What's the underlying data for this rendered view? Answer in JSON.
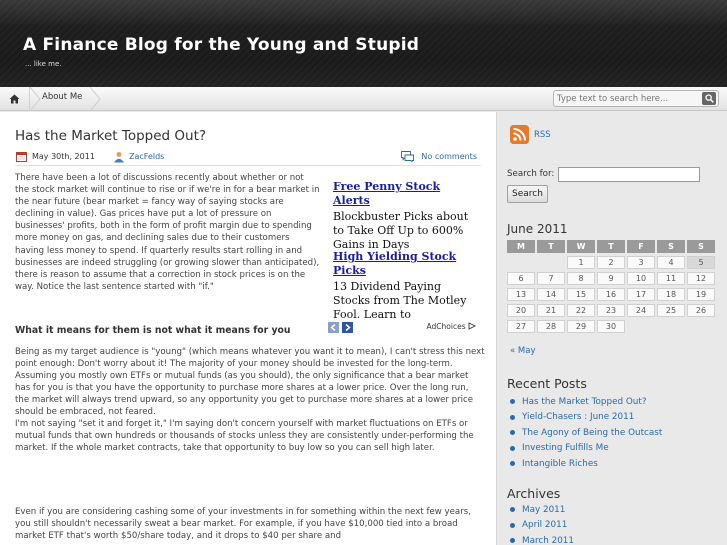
{
  "site": {
    "title": "A Finance Blog for the Young and Stupid",
    "description": "... like me."
  },
  "nav": {
    "home_icon": "home-icon",
    "items": [
      {
        "label": "About Me"
      }
    ],
    "search_placeholder": "Type text to search here..."
  },
  "post": {
    "title": "Has the Market Topped Out?",
    "date": "May 30th, 2011",
    "author": "ZacFelds",
    "comments": "No comments",
    "para1": "There have been a lot of discussions recently about whether or not the stock market will continue to rise or if we're in for a bear market in the near future (bear market = fancy way of saying stocks are declining in value). Gas prices have put a lot of pressure on businesses' profits, both in the form of profit margin due to spending more money on gas, and declining sales due to their customers having less money to spend. If quarterly results start rolling in and businesses are indeed struggling (or growing slower than anticipated), there is reason to assume that a correction in stock prices is on the way. Notice the last sentence started with \"if.\"",
    "subheading": "What it means for them is not what it means for you",
    "para2": "Being as my target audience is \"young\" (which means whatever you want it to mean), I can't stress this next point enough: Don't worry about it! The majority of your money should be invested for the long-term. Assuming you mostly own ETFs or mutual funds (as you should), the only significance that a bear market has for you is that you have the opportunity to purchase more shares at a lower price. Over the long run, the market will always trend upward, so any opportunity you get to purchase more shares at a lower price should be embraced, not feared.",
    "para3": "I'm not saying \"set it and forget it,\" I'm saying don't concern yourself with market fluctuations on ETFs or mutual funds that own hundreds or thousands of stocks unless they are consistently under-performing the market. If the whole market contracts, take that opportunity to buy low so you can sell high later.",
    "para4": "Even if you are considering cashing some of your investments in for something within the next few years, you still shouldn't necessarily sweat a bear market. For example, if you have $10,000 tied into a broad market ETF that's worth $50/share today, and it drops to $40 per share and"
  },
  "ad": {
    "link1": "Free Penny Stock Alerts",
    "body1": "Blockbuster Picks about to Take Off Up to 600% Gains in Days",
    "link2": "High Yielding Stock Picks",
    "body2": "13 Dividend Paying Stocks from The Motley Fool. Learn to",
    "adchoices": "AdChoices"
  },
  "sidebar": {
    "rss_label": "RSS",
    "search_label": "Search for:",
    "search_button": "Search",
    "calendar": {
      "title": "June 2011",
      "days": [
        "M",
        "T",
        "W",
        "T",
        "F",
        "S",
        "S"
      ],
      "weeks": [
        [
          "",
          "",
          "1",
          "2",
          "3",
          "4",
          "5"
        ],
        [
          "6",
          "7",
          "8",
          "9",
          "10",
          "11",
          "12"
        ],
        [
          "13",
          "14",
          "15",
          "16",
          "17",
          "18",
          "19"
        ],
        [
          "20",
          "21",
          "22",
          "23",
          "24",
          "25",
          "26"
        ],
        [
          "27",
          "28",
          "29",
          "30",
          "",
          "",
          ""
        ]
      ],
      "today": "5",
      "prev": "« May"
    },
    "recent_title": "Recent Posts",
    "recent": [
      "Has the Market Topped Out?",
      "Yield-Chasers : June 2011",
      "The Agony of Being the Outcast",
      "Investing Fulfills Me",
      "Intangible Riches"
    ],
    "archives_title": "Archives",
    "archives": [
      "May 2011",
      "April 2011",
      "March 2011"
    ]
  },
  "colors": {
    "link": "#2a6aa8",
    "header_bg": "#1e1e1e",
    "ad_link": "#1a1aa8"
  }
}
